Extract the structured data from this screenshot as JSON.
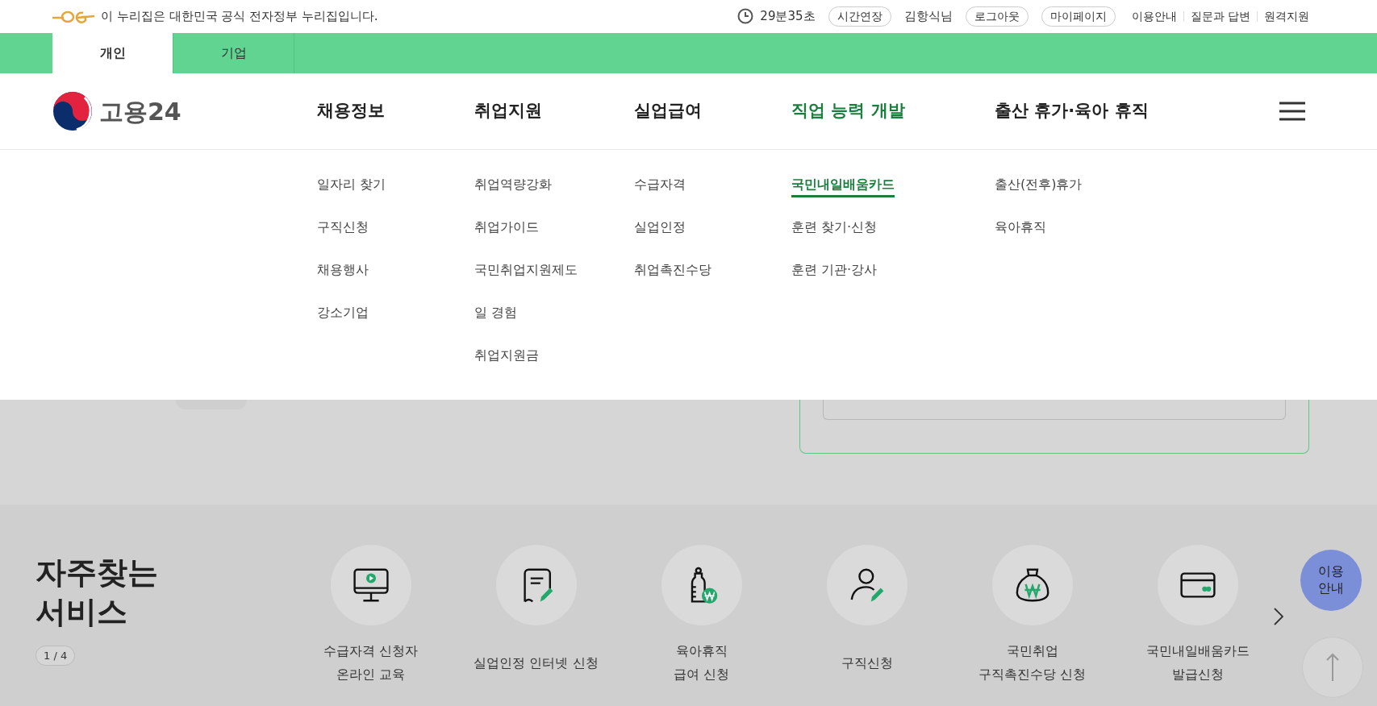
{
  "gov_banner": {
    "text": "이 누리집은 대한민국 공식 전자정부 누리집입니다."
  },
  "session": {
    "timer": "29분35초",
    "extend_button": "시간연장",
    "user": "김항식님",
    "logout_button": "로그아웃",
    "mypage_button": "마이페이지"
  },
  "util_links": [
    "이용안내",
    "질문과 답변",
    "원격지원"
  ],
  "tabs": [
    {
      "label": "개인",
      "selected": true
    },
    {
      "label": "기업",
      "selected": false
    }
  ],
  "logo": {
    "text": "고용24"
  },
  "menu": [
    {
      "label": "채용정보",
      "selected": false,
      "children": [
        {
          "label": "일자리 찾기",
          "selected": false
        },
        {
          "label": "구직신청",
          "selected": false
        },
        {
          "label": "채용행사",
          "selected": false
        },
        {
          "label": "강소기업",
          "selected": false
        }
      ]
    },
    {
      "label": "취업지원",
      "selected": false,
      "children": [
        {
          "label": "취업역량강화",
          "selected": false
        },
        {
          "label": "취업가이드",
          "selected": false
        },
        {
          "label": "국민취업지원제도",
          "selected": false
        },
        {
          "label": "일 경험",
          "selected": false
        },
        {
          "label": "취업지원금",
          "selected": false
        }
      ]
    },
    {
      "label": "실업급여",
      "selected": false,
      "children": [
        {
          "label": "수급자격",
          "selected": false
        },
        {
          "label": "실업인정",
          "selected": false
        },
        {
          "label": "취업촉진수당",
          "selected": false
        }
      ]
    },
    {
      "label": "직업 능력 개발",
      "selected": true,
      "children": [
        {
          "label": "국민내일배움카드",
          "selected": true
        },
        {
          "label": "훈련 찾기·신청",
          "selected": false
        },
        {
          "label": "훈련 기관·강사",
          "selected": false
        }
      ]
    },
    {
      "label": "출산 휴가·육아 휴직",
      "selected": false,
      "children": [
        {
          "label": "출산(전후)휴가",
          "selected": false
        },
        {
          "label": "육아휴직",
          "selected": false
        }
      ]
    }
  ],
  "services": {
    "title": "자주찾는 서비스",
    "pager": "1 / 4",
    "items": [
      {
        "lines": [
          "수급자격 신청자",
          "온라인 교육"
        ]
      },
      {
        "lines": [
          "실업인정 인터넷 신청"
        ]
      },
      {
        "lines": [
          "육아휴직",
          "급여 신청"
        ]
      },
      {
        "lines": [
          "구직신청"
        ]
      },
      {
        "lines": [
          "국민취업",
          "구직촉진수당 신청"
        ]
      },
      {
        "lines": [
          "국민내일배움카드",
          "발급신청"
        ]
      }
    ]
  },
  "help_button": {
    "lines": [
      "이용",
      "안내"
    ]
  }
}
